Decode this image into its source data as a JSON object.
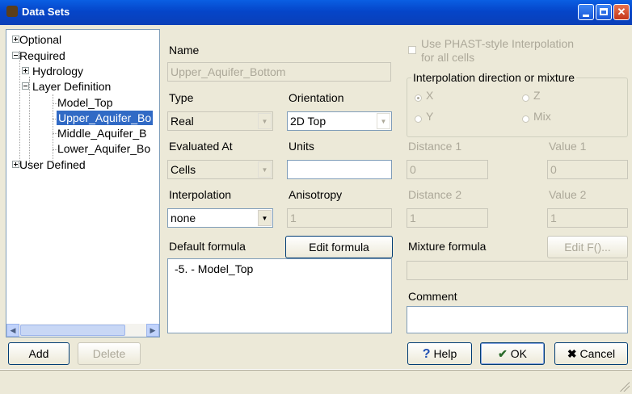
{
  "window": {
    "title": "Data Sets",
    "controls": [
      "minimize",
      "maximize",
      "close"
    ]
  },
  "tree": {
    "optional": "Optional",
    "required": "Required",
    "hydrology": "Hydrology",
    "layer_definition": "Layer Definition",
    "model_top": "Model_Top",
    "upper_aquifer": "Upper_Aquifer_Bo",
    "middle_aquifer": "Middle_Aquifer_B",
    "lower_aquifer": "Lower_Aquifer_Bo",
    "user_defined": "User Defined"
  },
  "form": {
    "name_label": "Name",
    "name_value": "Upper_Aquifer_Bottom",
    "type_label": "Type",
    "type_value": "Real",
    "orientation_label": "Orientation",
    "orientation_value": "2D Top",
    "evaluated_label": "Evaluated At",
    "evaluated_value": "Cells",
    "units_label": "Units",
    "units_value": "",
    "interp_label": "Interpolation",
    "interp_value": "none",
    "aniso_label": "Anisotropy",
    "aniso_value": "1",
    "default_formula_label": "Default formula",
    "edit_formula": "Edit formula",
    "formula_text": "-5. - Model_Top"
  },
  "right": {
    "phast_line1": "Use PHAST-style Interpolation",
    "phast_line2": "for all cells",
    "direction_label": "Interpolation direction or mixture",
    "radio_x": "X",
    "radio_z": "Z",
    "radio_y": "Y",
    "radio_mix": "Mix",
    "selected_direction": "X",
    "distance1": "Distance 1",
    "value1": "Value 1",
    "distance1_value": "0",
    "value1_value": "0",
    "distance2": "Distance 2",
    "value2": "Value 2",
    "distance2_value": "1",
    "value2_value": "1",
    "mixture_label": "Mixture formula",
    "edit_f": "Edit F()...",
    "mixture_value": "",
    "comment_label": "Comment",
    "comment_value": ""
  },
  "buttons": {
    "add": "Add",
    "delete": "Delete",
    "help": "Help",
    "ok": "OK",
    "cancel": "Cancel"
  }
}
